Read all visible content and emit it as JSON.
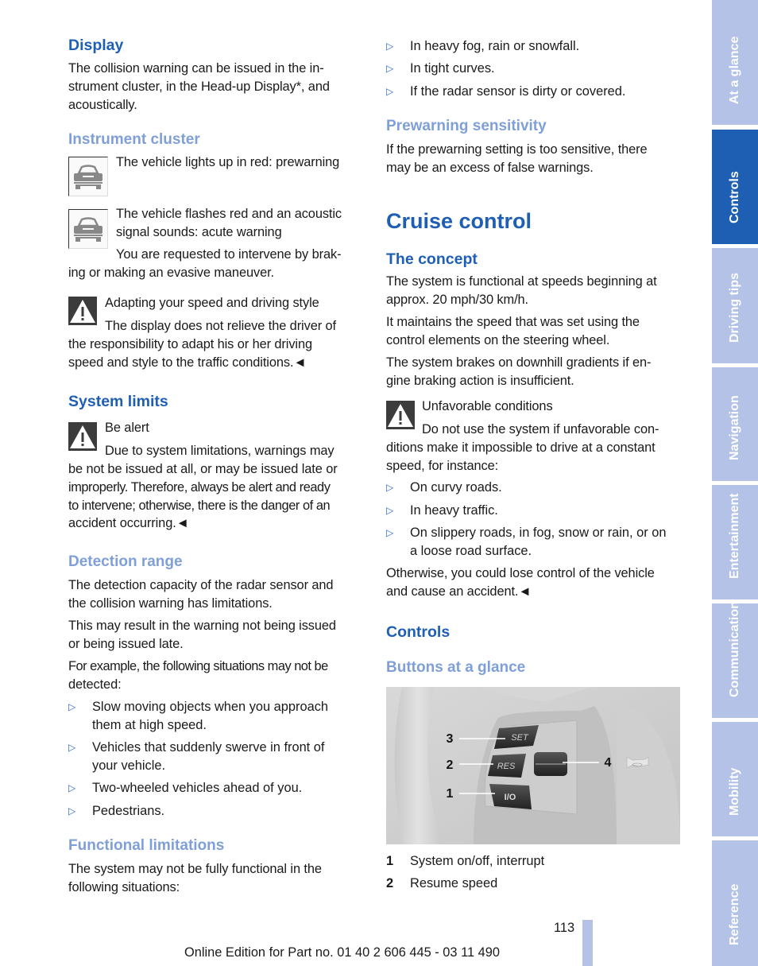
{
  "left_column": {
    "display": {
      "heading": "Display",
      "text": "The collision warning can be issued in the in­strument cluster, in the Head-up Display*, and acoustically.",
      "lines": [
        "The collision warning can be issued in the in-",
        "strument cluster, in the Head-up Display*, and",
        "acoustically."
      ]
    },
    "instrument_cluster": {
      "heading": "Instrument cluster",
      "item1": {
        "icon": "car-front-icon",
        "text": "The vehicle lights up in red: prewarning"
      },
      "item2": {
        "icon": "car-front-icon",
        "lines": [
          "The vehicle flashes red and an acoustic",
          "signal sounds: acute warning"
        ],
        "followup_lines": [
          "You are requested to intervene by brak-",
          "ing or making an evasive maneuver."
        ]
      }
    },
    "warning_adapting": {
      "icon": "warning-triangle-icon",
      "title": "Adapting your speed and driving style",
      "lines": [
        "The display does not relieve the driver of",
        "the responsibility to adapt his or her driving",
        "speed and style to the traffic conditions.◄"
      ]
    },
    "system_limits": {
      "heading": "System limits",
      "warning": {
        "icon": "warning-triangle-icon",
        "title": "Be alert",
        "lines": [
          "Due to system limitations, warnings may",
          "be not be issued at all, or may be issued late or",
          "improperly. Therefore, always be alert and ready",
          "to intervene; otherwise, there is the danger of an",
          "accident occurring.◄"
        ]
      }
    },
    "detection_range": {
      "heading": "Detection range",
      "para1": [
        "The detection capacity of the radar sensor and",
        "the collision warning has limitations."
      ],
      "para2": [
        "This may result in the warning not being issued",
        "or being issued late."
      ],
      "para3": [
        "For example, the following situations may not be",
        "detected:"
      ],
      "bullets": [
        [
          "Slow moving objects when you approach",
          "them at high speed."
        ],
        [
          "Vehicles that suddenly swerve in front of",
          "your vehicle."
        ],
        [
          "Two-wheeled vehicles ahead of you."
        ],
        [
          "Pedestrians."
        ]
      ]
    },
    "functional_limitations": {
      "heading": "Functional limitations",
      "lines": [
        "The system may not be fully functional in the",
        "following situations:"
      ]
    }
  },
  "right_column": {
    "limitation_bullets": [
      "In heavy fog, rain or snowfall.",
      "In tight curves.",
      "If the radar sensor is dirty or covered."
    ],
    "prewarning_sensitivity": {
      "heading": "Prewarning sensitivity",
      "lines": [
        "If the prewarning setting is too sensitive, there",
        "may be an excess of false warnings."
      ]
    },
    "cruise_control": {
      "title": "Cruise control",
      "concept": {
        "heading": "The concept",
        "para1": [
          "The system is functional at speeds beginning at",
          "approx. 20 mph/30 km/h."
        ],
        "para2": [
          "It maintains the speed that was set using the",
          "control elements on the steering wheel."
        ],
        "para3": [
          "The system brakes on downhill gradients if en-",
          "gine braking action is insufficient."
        ]
      },
      "warning": {
        "icon": "warning-triangle-icon",
        "title": "Unfavorable conditions",
        "lines": [
          "Do not use the system if unfavorable con-",
          "ditions make it impossible to drive at a constant",
          "speed, for instance:"
        ],
        "bullets": [
          [
            "On curvy roads."
          ],
          [
            "In heavy traffic."
          ],
          [
            "On slippery roads, in fog, snow or rain, or on",
            "a loose road surface."
          ]
        ],
        "closing": [
          "Otherwise, you could lose control of the vehicle",
          "and cause an accident.◄"
        ]
      },
      "controls": {
        "heading": "Controls",
        "subheading": "Buttons at a glance",
        "figure": {
          "buttons": {
            "set": "SET",
            "res": "RES",
            "io": "I/O"
          },
          "callouts": [
            "1",
            "2",
            "3",
            "4"
          ]
        },
        "legend": [
          {
            "num": "1",
            "label": "System on/off, interrupt"
          },
          {
            "num": "2",
            "label": "Resume speed"
          }
        ]
      }
    }
  },
  "bullet_marker": "▷",
  "footer": {
    "page_number": "113",
    "edition": "Online Edition for Part no. 01 40 2 606 445 - 03 11 490"
  },
  "sidebar": {
    "tabs": [
      {
        "label": "At a glance",
        "active": false
      },
      {
        "label": "Controls",
        "active": true
      },
      {
        "label": "Driving tips",
        "active": false
      },
      {
        "label": "Navigation",
        "active": false
      },
      {
        "label": "Entertainment",
        "active": false
      },
      {
        "label": "Communication",
        "active": false
      },
      {
        "label": "Mobility",
        "active": false
      },
      {
        "label": "Reference",
        "active": false
      }
    ]
  },
  "colors": {
    "heading_blue": "#1e5fb4",
    "subheading_blue": "#7f9fd8",
    "tab_inactive": "#b3c2e6",
    "tab_active": "#1e5fb4"
  }
}
